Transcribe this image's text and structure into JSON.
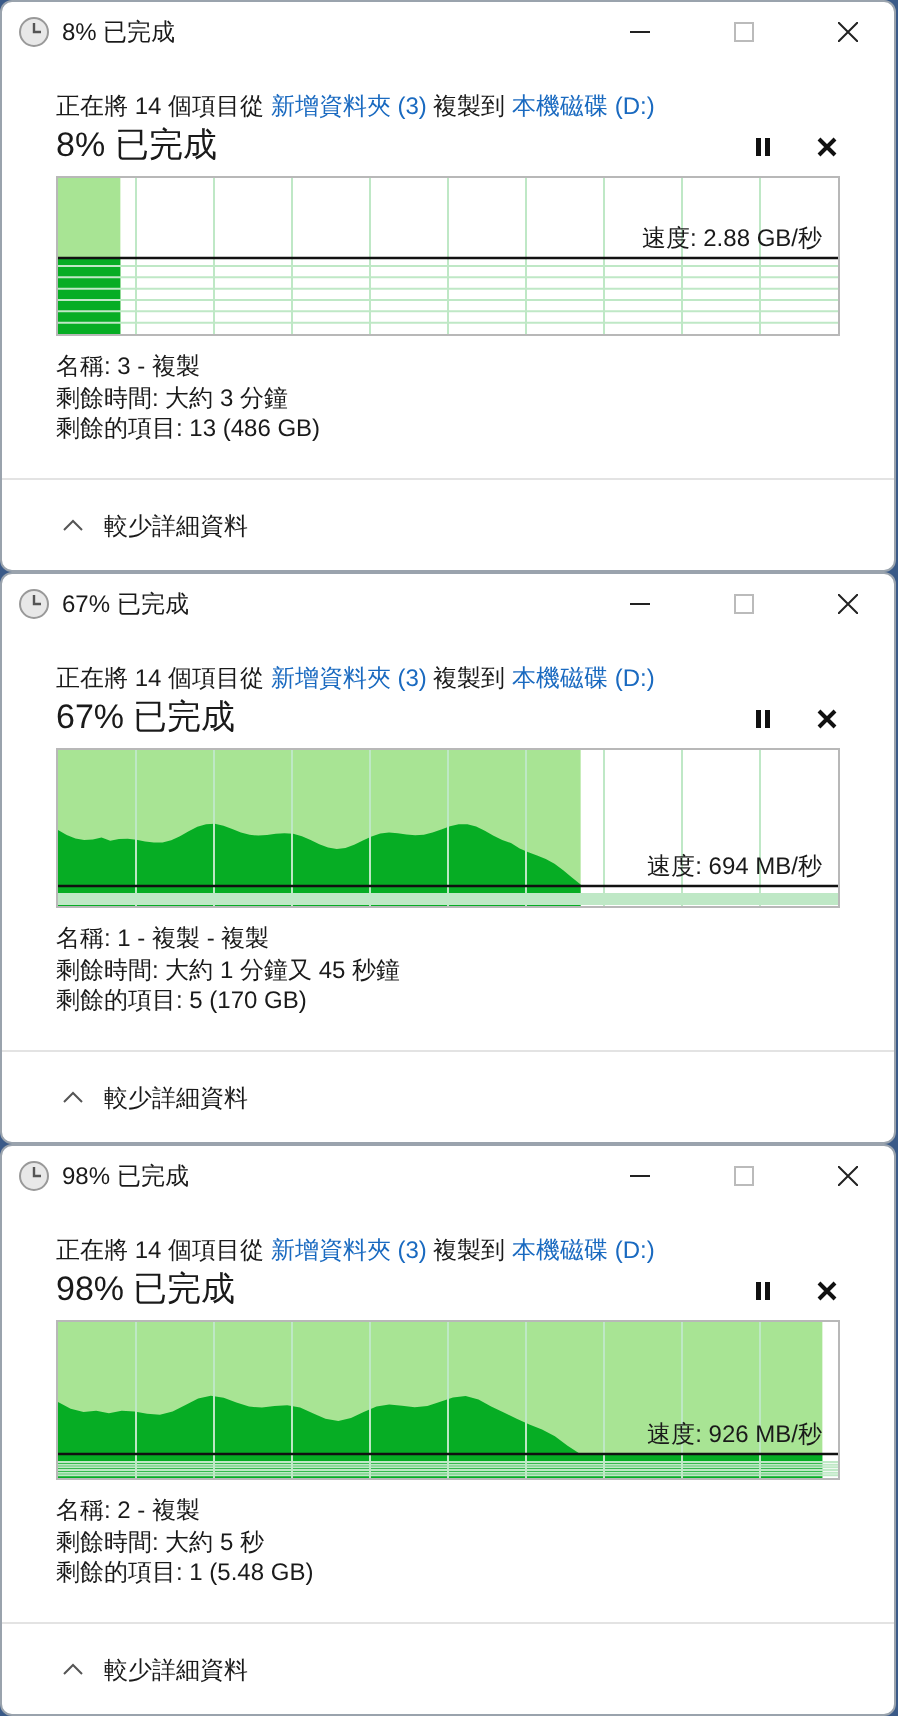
{
  "dialogs": [
    {
      "title": "8% 已完成",
      "description": [
        {
          "kind": "plain",
          "text": "正在將 14 個項目從"
        },
        {
          "kind": "link",
          "text": "新增資料夾 (3)"
        },
        {
          "kind": "plain",
          "text": "複製到"
        },
        {
          "kind": "link",
          "text": "本機磁碟 (D:)"
        }
      ],
      "heading": "8% 已完成",
      "level": 0.08,
      "speed": "速度: 2.88 GB/秒",
      "details": [
        "名稱: 3 - 複製",
        "剩餘時間: 大約 3 分鐘",
        "剩餘的項目: 13 (486 GB)"
      ],
      "toggle": "較少詳細資料"
    },
    {
      "title": "67% 已完成",
      "description": [
        {
          "kind": "plain",
          "text": "正在將 14 個項目從"
        },
        {
          "kind": "link",
          "text": "新增資料夾 (3)"
        },
        {
          "kind": "plain",
          "text": "複製到"
        },
        {
          "kind": "link",
          "text": "本機磁碟 (D:)"
        }
      ],
      "heading": "67% 已完成",
      "level": 0.67,
      "speed": "速度: 694 MB/秒",
      "details": [
        "名稱: 1 - 複製 - 複製",
        "剩餘時間: 大約 1 分鐘又 45 秒鐘",
        "剩餘的項目: 5 (170 GB)"
      ],
      "toggle": "較少詳細資料"
    },
    {
      "title": "98% 已完成",
      "description": [
        {
          "kind": "plain",
          "text": "正在將 14 個項目從"
        },
        {
          "kind": "link",
          "text": "新增資料夾 (3)"
        },
        {
          "kind": "plain",
          "text": "複製到"
        },
        {
          "kind": "link",
          "text": "本機磁碟 (D:)"
        }
      ],
      "heading": "98% 已完成",
      "level": 0.98,
      "speed": "速度: 926 MB/秒",
      "details": [
        "名稱: 2 - 複製",
        "剩餘時間: 大約 5 秒",
        "剩餘的項目: 1 (5.48 GB)"
      ],
      "toggle": "較少詳細資料"
    }
  ]
}
